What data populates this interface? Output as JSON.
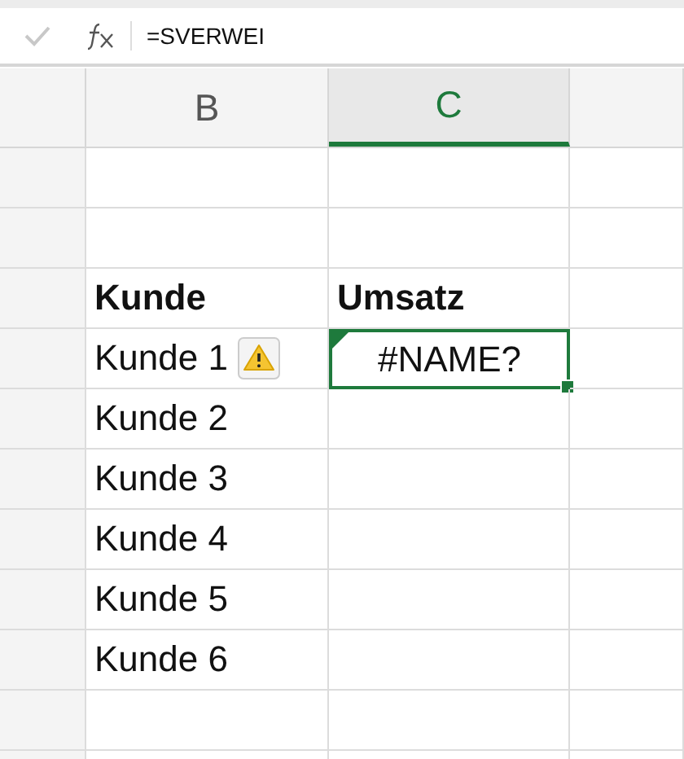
{
  "formula_bar": {
    "value": "=SVERWEI"
  },
  "columns": [
    {
      "label": "B",
      "selected": false
    },
    {
      "label": "C",
      "selected": true
    }
  ],
  "rows": [
    {
      "kind": "empty"
    },
    {
      "kind": "empty"
    },
    {
      "kind": "header",
      "b": "Kunde",
      "c": "Umsatz"
    },
    {
      "kind": "data",
      "b": "Kunde 1",
      "c": "#NAME?",
      "warning": true,
      "selected": true
    },
    {
      "kind": "data",
      "b": "Kunde 2",
      "warning": false,
      "selected": false
    },
    {
      "kind": "data",
      "b": "Kunde 3",
      "warning": false,
      "selected": false
    },
    {
      "kind": "data",
      "b": "Kunde 4",
      "warning": false,
      "selected": false
    },
    {
      "kind": "data",
      "b": "Kunde 5",
      "warning": false,
      "selected": false
    },
    {
      "kind": "data",
      "b": "Kunde 6",
      "warning": false,
      "selected": false
    },
    {
      "kind": "empty"
    },
    {
      "kind": "empty"
    }
  ]
}
